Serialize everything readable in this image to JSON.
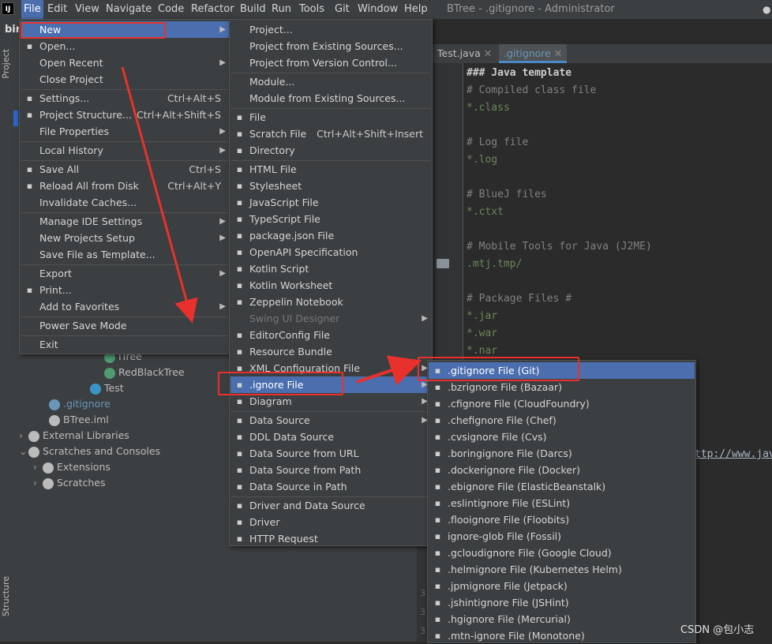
{
  "window": {
    "logo": "IJ",
    "title": "BTree - .gitignore - Administrator"
  },
  "menubar": [
    "File",
    "Edit",
    "View",
    "Navigate",
    "Code",
    "Refactor",
    "Build",
    "Run",
    "Tools",
    "Git",
    "Window",
    "Help"
  ],
  "side_tools": {
    "project": "Project",
    "structure": "Structure"
  },
  "project": {
    "title": "bir",
    "tree": [
      {
        "label": "ITree",
        "icon": "interface-icon",
        "color": "#4f9b6f"
      },
      {
        "label": "RedBlackTree",
        "icon": "interface-icon",
        "color": "#4f9b6f"
      },
      {
        "label": "Test",
        "icon": "class-icon",
        "color": "#3a95c6"
      },
      {
        "label": ".gitignore",
        "icon": "gitignore-icon",
        "color": "#6897bb"
      },
      {
        "label": "BTree.iml",
        "icon": "file-icon",
        "color": "#bbbbbb"
      },
      {
        "label": "External Libraries",
        "icon": "library-icon",
        "color": "#bbbbbb"
      },
      {
        "label": "Scratches and Consoles",
        "icon": "scratch-icon",
        "color": "#bbbbbb"
      },
      {
        "label": "Extensions",
        "icon": "folder-icon",
        "color": "#bbbbbb"
      },
      {
        "label": "Scratches",
        "icon": "folder-icon",
        "color": "#bbbbbb"
      }
    ]
  },
  "editor": {
    "tabs": [
      "Test.java",
      ".gitignore"
    ],
    "lines": [
      {
        "t": "### Java template",
        "k": "hdr"
      },
      {
        "t": "# Compiled class file",
        "k": "cm"
      },
      {
        "t": "*.class",
        "k": "pt"
      },
      {
        "t": "",
        "k": "pt"
      },
      {
        "t": "# Log file",
        "k": "cm"
      },
      {
        "t": "*.log",
        "k": "pt"
      },
      {
        "t": "",
        "k": "pt"
      },
      {
        "t": "# BlueJ files",
        "k": "cm"
      },
      {
        "t": "*.ctxt",
        "k": "pt"
      },
      {
        "t": "",
        "k": "pt"
      },
      {
        "t": "# Mobile Tools for Java (J2ME)",
        "k": "cm"
      },
      {
        "t": ".mtj.tmp/",
        "k": "pt"
      },
      {
        "t": "",
        "k": "pt"
      },
      {
        "t": "# Package Files #",
        "k": "cm"
      },
      {
        "t": "*.jar",
        "k": "pt"
      },
      {
        "t": "*.war",
        "k": "pt"
      },
      {
        "t": "*.nar",
        "k": "pt"
      }
    ],
    "partial_url": "ttp://www.java",
    "gutter_numbers": [
      "3",
      "3",
      "3"
    ]
  },
  "file_menu": [
    {
      "label": "New",
      "arrow": true,
      "sel": true
    },
    {
      "label": "Open...",
      "icon": "folder-icon"
    },
    {
      "label": "Open Recent",
      "arrow": true
    },
    {
      "label": "Close Project"
    },
    {
      "sep": true
    },
    {
      "label": "Settings...",
      "sc": "Ctrl+Alt+S",
      "icon": "wrench-icon"
    },
    {
      "label": "Project Structure...",
      "sc": "Ctrl+Alt+Shift+S",
      "icon": "structure-icon"
    },
    {
      "label": "File Properties",
      "arrow": true
    },
    {
      "sep": true
    },
    {
      "label": "Local History",
      "arrow": true
    },
    {
      "sep": true
    },
    {
      "label": "Save All",
      "sc": "Ctrl+S",
      "icon": "save-icon"
    },
    {
      "label": "Reload All from Disk",
      "sc": "Ctrl+Alt+Y",
      "icon": "reload-icon"
    },
    {
      "label": "Invalidate Caches..."
    },
    {
      "sep": true
    },
    {
      "label": "Manage IDE Settings",
      "arrow": true
    },
    {
      "label": "New Projects Setup",
      "arrow": true
    },
    {
      "label": "Save File as Template..."
    },
    {
      "sep": true
    },
    {
      "label": "Export",
      "arrow": true
    },
    {
      "label": "Print...",
      "icon": "print-icon"
    },
    {
      "label": "Add to Favorites",
      "arrow": true
    },
    {
      "sep": true
    },
    {
      "label": "Power Save Mode"
    },
    {
      "sep": true
    },
    {
      "label": "Exit"
    }
  ],
  "new_menu": [
    {
      "label": "Project..."
    },
    {
      "label": "Project from Existing Sources..."
    },
    {
      "label": "Project from Version Control..."
    },
    {
      "sep": true
    },
    {
      "label": "Module..."
    },
    {
      "label": "Module from Existing Sources..."
    },
    {
      "sep": true
    },
    {
      "label": "File",
      "icon": "file-icon"
    },
    {
      "label": "Scratch File",
      "sc": "Ctrl+Alt+Shift+Insert",
      "icon": "scratch-icon"
    },
    {
      "label": "Directory",
      "icon": "folder-icon"
    },
    {
      "sep": true
    },
    {
      "label": "HTML File",
      "icon": "html-icon"
    },
    {
      "label": "Stylesheet",
      "icon": "css-icon"
    },
    {
      "label": "JavaScript File",
      "icon": "js-icon"
    },
    {
      "label": "TypeScript File",
      "icon": "ts-icon"
    },
    {
      "label": "package.json File",
      "icon": "npm-icon"
    },
    {
      "label": "OpenAPI Specification",
      "icon": "openapi-icon"
    },
    {
      "label": "Kotlin Script",
      "icon": "kotlin-icon"
    },
    {
      "label": "Kotlin Worksheet",
      "icon": "kotlin-icon"
    },
    {
      "label": "Zeppelin Notebook",
      "icon": "zeppelin-icon"
    },
    {
      "label": "Swing UI Designer",
      "arrow": true,
      "dis": true
    },
    {
      "label": "EditorConfig File",
      "icon": "editorconfig-icon"
    },
    {
      "label": "Resource Bundle",
      "icon": "bundle-icon"
    },
    {
      "label": "XML Configuration File",
      "arrow": true,
      "icon": "xml-icon"
    },
    {
      "label": ".ignore File",
      "arrow": true,
      "sel": true,
      "icon": "ignore-icon"
    },
    {
      "label": "Diagram",
      "arrow": true,
      "icon": "diagram-icon"
    },
    {
      "sep": true
    },
    {
      "label": "Data Source",
      "arrow": true,
      "icon": "datasource-icon"
    },
    {
      "label": "DDL Data Source",
      "icon": "ddl-icon"
    },
    {
      "label": "Data Source from URL",
      "icon": "url-icon"
    },
    {
      "label": "Data Source from Path",
      "icon": "path-icon"
    },
    {
      "label": "Data Source in Path",
      "icon": "path-icon"
    },
    {
      "sep": true
    },
    {
      "label": "Driver and Data Source",
      "icon": "driver-icon"
    },
    {
      "label": "Driver",
      "icon": "driver-icon"
    },
    {
      "label": "HTTP Request",
      "icon": "api-icon"
    }
  ],
  "ignore_menu": [
    {
      "label": ".gitignore File (Git)",
      "sel": true,
      "icon": "git-icon"
    },
    {
      "label": ".bzrignore File (Bazaar)",
      "icon": "bazaar-icon"
    },
    {
      "label": ".cfignore File (CloudFoundry)",
      "icon": "cloudfoundry-icon"
    },
    {
      "label": ".chefignore File (Chef)",
      "icon": "chef-icon"
    },
    {
      "label": ".cvsignore File (Cvs)",
      "icon": "cvs-icon"
    },
    {
      "label": ".boringignore File (Darcs)",
      "icon": "darcs-icon"
    },
    {
      "label": ".dockerignore File (Docker)",
      "icon": "docker-icon"
    },
    {
      "label": ".ebignore File (ElasticBeanstalk)",
      "icon": "beanstalk-icon"
    },
    {
      "label": ".eslintignore File (ESLint)",
      "icon": "eslint-icon"
    },
    {
      "label": ".flooignore File (Floobits)",
      "icon": "floobits-icon"
    },
    {
      "label": "ignore-glob File (Fossil)",
      "icon": "fossil-icon"
    },
    {
      "label": ".gcloudignore File (Google Cloud)",
      "icon": "gcloud-icon"
    },
    {
      "label": ".helmignore File (Kubernetes Helm)",
      "icon": "helm-icon"
    },
    {
      "label": ".jpmignore File (Jetpack)",
      "icon": "jetpack-icon"
    },
    {
      "label": ".jshintignore File (JSHint)",
      "icon": "jshint-icon"
    },
    {
      "label": ".hgignore File (Mercurial)",
      "icon": "mercurial-icon"
    },
    {
      "label": ".mtn-ignore File (Monotone)",
      "icon": "monotone-icon"
    }
  ],
  "watermark": "CSDN @包小志",
  "colors": {
    "highlight": "#4b6eaf",
    "annotation": "#e8312d"
  }
}
